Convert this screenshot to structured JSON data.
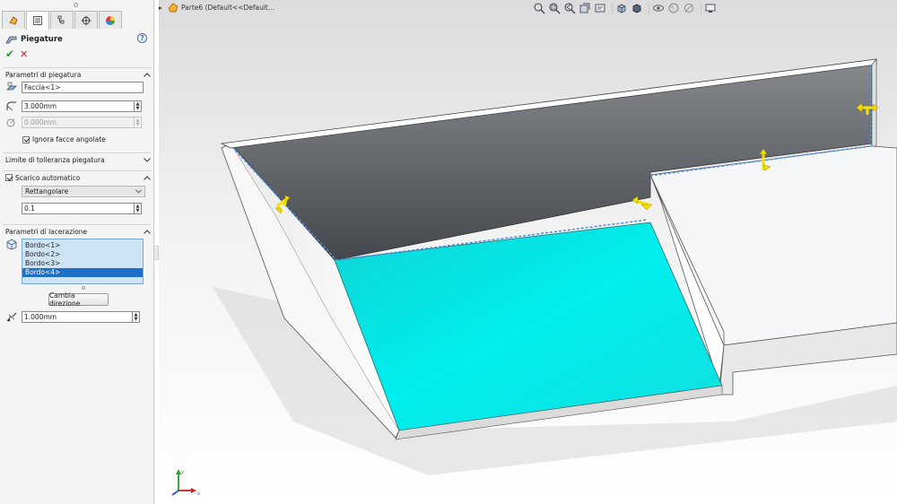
{
  "feature": {
    "title": "Piegature",
    "help_icon": "?",
    "ok_icon": "✔",
    "cancel_icon": "✕"
  },
  "tabs": [
    {
      "icon": "feature-manager-icon",
      "active": false
    },
    {
      "icon": "property-manager-icon",
      "active": true
    },
    {
      "icon": "configuration-manager-icon",
      "active": false
    },
    {
      "icon": "dimxpert-icon",
      "active": false
    },
    {
      "icon": "display-manager-icon",
      "active": false
    }
  ],
  "bend_params": {
    "header": "Parametri di piegatura",
    "fixed_face": "Faccia<1>",
    "radius": "3.000mm",
    "thickness": "0.000mm",
    "ignore_beveled_label": "Ignora facce angolate"
  },
  "tolerance": {
    "header": "Limite di tolleranza piegatura"
  },
  "auto_relief": {
    "header": "Scarico automatico",
    "type": "Rettangolare",
    "ratio": "0.1"
  },
  "rip_params": {
    "header": "Parametri di lacerazione",
    "edges": [
      "Bordo<1>",
      "Bordo<2>",
      "Bordo<3>",
      "Bordo<4>"
    ],
    "selected_index": 3,
    "change_direction_label": "Cambia direzione",
    "rip_gap": "1.000mm"
  },
  "viewport": {
    "tree_label": "Parte6  (Default<<Default...",
    "triad_x": "x",
    "triad_y": "y",
    "heads_up_icons": [
      "zoom-to-fit-icon",
      "zoom-to-area-icon",
      "previous-view-icon",
      "section-view-icon",
      "dynamic-annotation-icon",
      "view-orientation-icon",
      "display-style-icon",
      "hide-show-items-icon",
      "edit-appearance-icon",
      "apply-scene-icon",
      "view-settings-icon"
    ]
  },
  "colors": {
    "selected_face": "#00e6e6",
    "dark_face": "#6e7278",
    "light_face": "#ffffff",
    "rip_edge_preview": "#4a90e2",
    "direction_arrow": "#f6e000",
    "list_selection": "#1e6fc6"
  }
}
